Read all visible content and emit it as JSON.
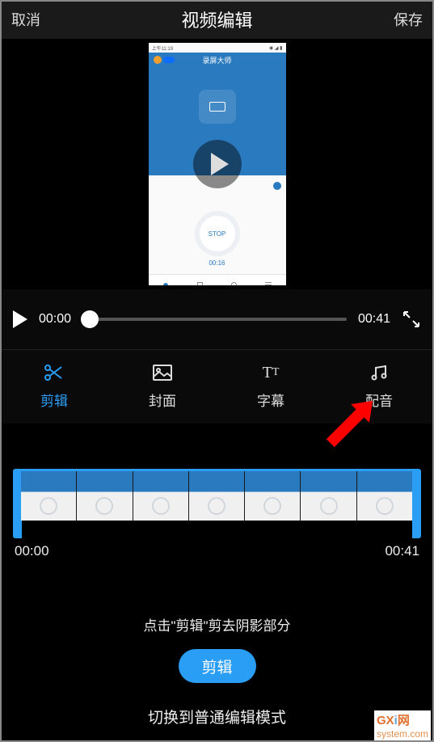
{
  "header": {
    "cancel": "取消",
    "title": "视频编辑",
    "save": "保存"
  },
  "phone": {
    "status_time": "上午11:19",
    "app_title": "录屏大师",
    "stop_label": "STOP",
    "rec_time": "00:16"
  },
  "player": {
    "current": "00:00",
    "duration": "00:41"
  },
  "tabs": {
    "trim": "剪辑",
    "cover": "封面",
    "subtitle": "字幕",
    "audio": "配音"
  },
  "timeline": {
    "start": "00:00",
    "end": "00:41"
  },
  "hint": "点击\"剪辑\"剪去阴影部分",
  "trim_button": "剪辑",
  "switch_mode": "切换到普通编辑模式",
  "watermark_prefix": "GX",
  "watermark_i": "i",
  "watermark_suffix": "网",
  "watermark_domain": "system.com"
}
